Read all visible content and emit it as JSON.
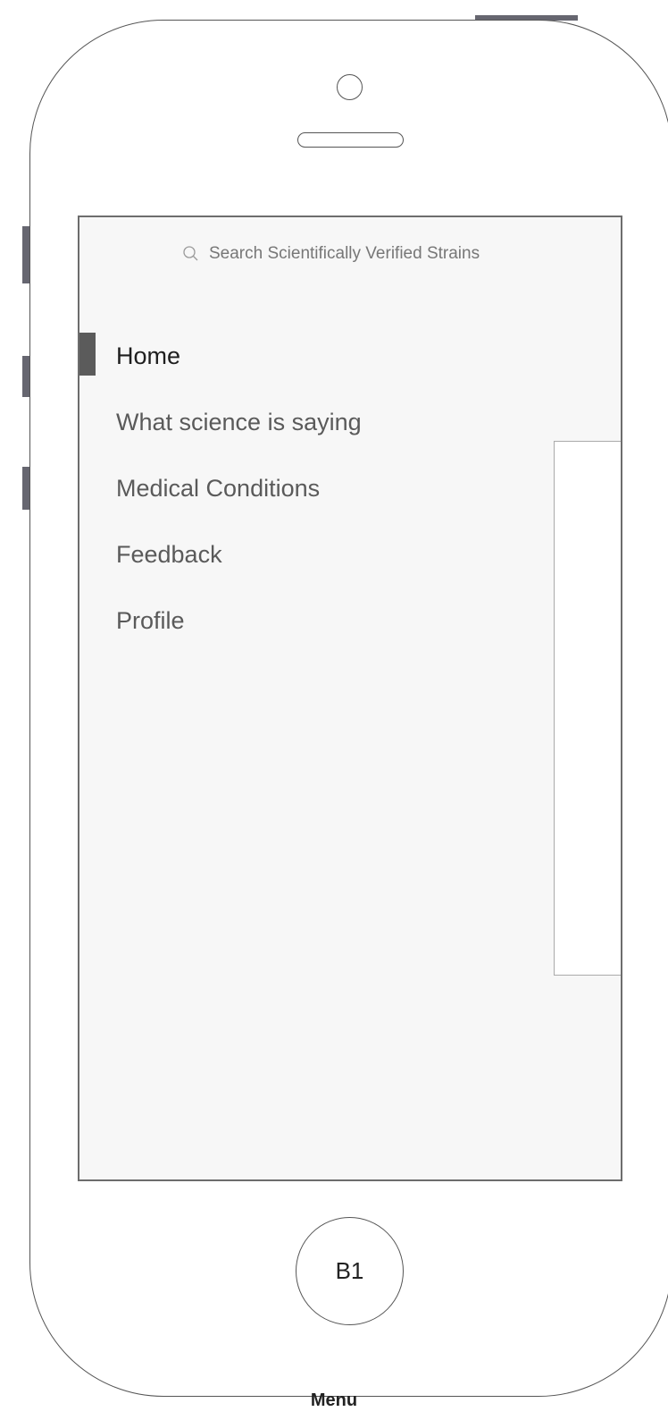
{
  "screen": {
    "search": {
      "placeholder": "Search Scientifically Verified Strains",
      "icon": "search-icon"
    },
    "menu": {
      "active_index": 0,
      "items": [
        {
          "label": "Home"
        },
        {
          "label": "What science is saying"
        },
        {
          "label": "Medical Conditions"
        },
        {
          "label": "Feedback"
        },
        {
          "label": "Profile"
        }
      ]
    }
  },
  "device": {
    "home_button_label": "B1"
  },
  "caption": "Menu"
}
